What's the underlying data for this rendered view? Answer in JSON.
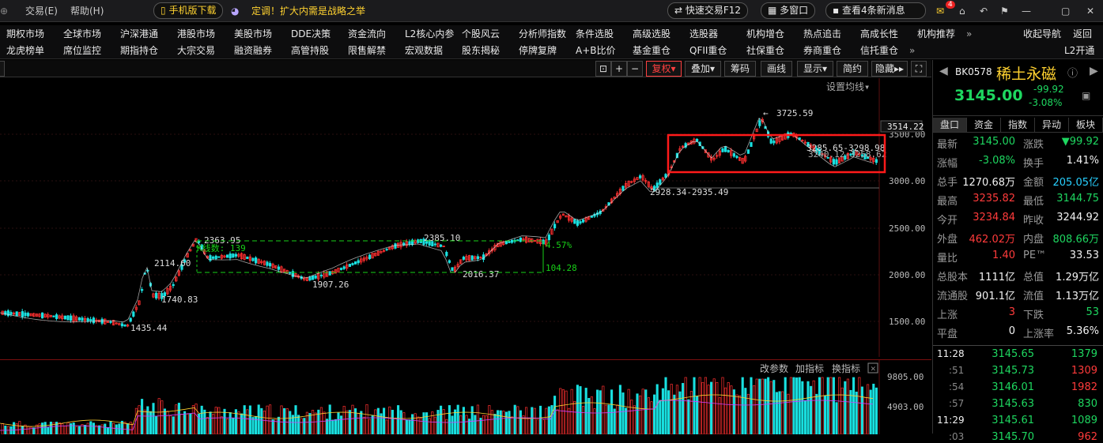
{
  "topbar": {
    "menu_trade": "交易(E)",
    "menu_help": "帮助(H)",
    "mobile_download": "手机版下载",
    "news_headline": "定调！扩大内需是战略之举",
    "quick_trade": "快速交易F12",
    "multi_window": "多窗口",
    "new_messages": "查看4条新消息",
    "msg_badge": "4"
  },
  "menu_row1": [
    "期权市场",
    "全球市场",
    "沪深港通",
    "港股市场",
    "美股市场",
    "DDE决策",
    "资金流向",
    "L2核心内参",
    "个股风云",
    "分析师指数",
    "条件选股",
    "高级选股",
    "选股器",
    "机构增仓",
    "热点追击",
    "高成长性",
    "机构推荐"
  ],
  "menu_row1_right": [
    "收起导航",
    "返回"
  ],
  "menu_row2": [
    "龙虎榜单",
    "席位监控",
    "期指持仓",
    "大宗交易",
    "融资融券",
    "高管持股",
    "限售解禁",
    "宏观数据",
    "股东揭秘",
    "停牌复牌",
    "A+B比价",
    "基金重仓",
    "QFII重仓",
    "社保重仓",
    "券商重仓",
    "信托重仓"
  ],
  "menu_row2_right": "L2开通",
  "chart_toolbar": {
    "fuquan": "复权",
    "diejia": "叠加",
    "chouma": "筹码",
    "huaxian": "画线",
    "xianshi": "显示",
    "jianjia": "简约",
    "yincang": "隐藏",
    "ma_setting": "设置均线"
  },
  "chart_data": {
    "type": "candlestick",
    "price_axis": [
      "3500.00",
      "3000.00",
      "2500.00",
      "2000.00",
      "1500.00"
    ],
    "last_price_tag": "3514.22",
    "annotations": {
      "high": "3725.59",
      "low1": "1435.44",
      "low2": "1740.83",
      "p2114": "2114.60",
      "p2363": "2363.95",
      "p1907": "1907.26",
      "p2385": "2385.10",
      "p2016": "2016.37",
      "range_low": "2928.34-2935.49",
      "range_right1": "3285.65-3298.98",
      "range_right2": "3240.12-3258.62",
      "kline_count": "K线数: 139",
      "pct": "4.57%",
      "diff": "104.28"
    }
  },
  "volume_pane": {
    "buttons": [
      "改参数",
      "加指标",
      "换指标"
    ],
    "axis": [
      "9805.00",
      "4903.00"
    ]
  },
  "quote": {
    "code": "BK0578",
    "name": "稀土永磁",
    "price": "3145.00",
    "change": "-99.92",
    "pct": "-3.08%",
    "tabs": [
      "盘口",
      "资金",
      "指数",
      "异动",
      "板块"
    ],
    "rows": [
      [
        "最新",
        "3145.00",
        "涨跌",
        "▼99.92"
      ],
      [
        "涨幅",
        "-3.08%",
        "换手",
        "1.41%"
      ],
      [
        "总手",
        "1270.68万",
        "金额",
        "205.05亿"
      ],
      [
        "最高",
        "3235.82",
        "最低",
        "3144.75"
      ],
      [
        "今开",
        "3234.84",
        "昨收",
        "3244.92"
      ],
      [
        "外盘",
        "462.02万",
        "内盘",
        "808.66万"
      ],
      [
        "量比",
        "1.40",
        "PE™",
        "33.53"
      ],
      [
        "总股本",
        "1111亿",
        "总值",
        "1.29万亿"
      ],
      [
        "流通股",
        "901.1亿",
        "流值",
        "1.13万亿"
      ],
      [
        "上涨",
        "3",
        "下跌",
        "53"
      ],
      [
        "平盘",
        "0",
        "上涨率",
        "5.36%"
      ]
    ],
    "ticks": [
      [
        "11:28",
        "3145.65",
        "1379"
      ],
      [
        ":51",
        "3145.73",
        "1309"
      ],
      [
        ":54",
        "3146.01",
        "1982"
      ],
      [
        ":57",
        "3145.63",
        "830"
      ],
      [
        "11:29",
        "3145.61",
        "1089"
      ],
      [
        ":03",
        "3145.70",
        "962"
      ]
    ]
  }
}
